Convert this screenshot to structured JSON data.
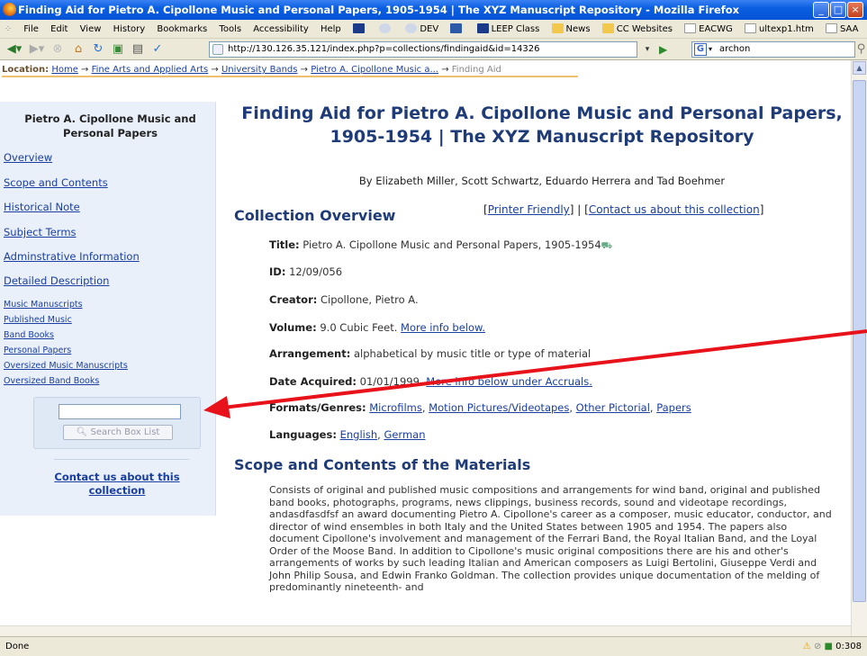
{
  "window": {
    "title": "Finding Aid for Pietro A. Cipollone Music and Personal Papers, 1905-1954 | The XYZ Manuscript Repository - Mozilla Firefox"
  },
  "menu": [
    "File",
    "Edit",
    "View",
    "History",
    "Bookmarks",
    "Tools",
    "Accessibility",
    "Help"
  ],
  "bookmarks": [
    "DEV",
    "LEEP Class",
    "News",
    "CC Websites",
    "EACWG",
    "ultexp1.htm",
    "SAA"
  ],
  "nav": {
    "url": "http://130.126.35.121/index.php?p=collections/findingaid&id=14326",
    "search_value": "archon"
  },
  "breadcrumb": {
    "label": "Location:",
    "items": [
      "Home",
      "Fine Arts and Applied Arts",
      "University Bands",
      "Pietro A. Cipollone Music a..."
    ],
    "current": "Finding Aid"
  },
  "sidebar": {
    "title": "Pietro A. Cipollone Music and Personal Papers",
    "links": [
      "Overview",
      "Scope and Contents",
      "Historical Note",
      "Subject Terms",
      "Adminstrative Information",
      "Detailed Description"
    ],
    "sublinks": [
      "Music Manuscripts",
      "Published Music",
      "Band Books",
      "Personal Papers",
      "Oversized Music Manuscripts",
      "Oversized Band Books"
    ],
    "search_button": "Search Box List",
    "contact": "Contact us about this collection"
  },
  "main": {
    "title": "Finding Aid for Pietro A. Cipollone Music and Personal Papers, 1905-1954 | The XYZ Manuscript Repository",
    "authors": "By Elizabeth Miller, Scott Schwartz, Eduardo Herrera and Tad Boehmer",
    "overview_heading": "Collection Overview",
    "printer_friendly": "Printer Friendly",
    "contact_collection": "Contact us about this collection",
    "fields": {
      "title_label": "Title:",
      "title_value": "Pietro A. Cipollone Music and Personal Papers, 1905-1954",
      "id_label": "ID:",
      "id_value": "12/09/056",
      "creator_label": "Creator:",
      "creator_value": "Cipollone, Pietro A.",
      "volume_label": "Volume:",
      "volume_value": "9.0 Cubic Feet.",
      "volume_link": "More info below.",
      "arrangement_label": "Arrangement:",
      "arrangement_value": "alphabetical by music title or type of material",
      "date_label": "Date Acquired:",
      "date_value": "01/01/1999.",
      "date_link": "More info below under Accruals.",
      "formats_label": "Formats/Genres:",
      "formats": [
        "Microfilms",
        "Motion Pictures/Videotapes",
        "Other Pictorial",
        "Papers"
      ],
      "languages_label": "Languages:",
      "languages": [
        "English",
        "German"
      ]
    },
    "scope_heading": "Scope and Contents of the Materials",
    "scope_text": "Consists of original and published music compositions and arrangements for wind band, original and published band books, photographs, programs, news clippings, business records, sound and videotape recordings, andasdfasdfsf an award documenting Pietro A. Cipollone's career as a composer, music educator, conductor, and director of wind ensembles in both Italy and the United States between 1905 and 1954. The papers also document Cipollone's involvement and management of the Ferrari Band, the Royal Italian Band, and the Loyal Order of the Moose Band. In addition to Cipollone's music original compositions there are his and other's arrangements of works by such leading Italian and American composers as Luigi Bertolini, Giuseppe Verdi and John Philip Sousa, and Edwin Franko Goldman. The collection provides unique documentation of the melding of predominantly nineteenth- and"
  },
  "status": {
    "text": "Done",
    "time": "0:308"
  },
  "colors": {
    "titlebar": "#0a5fe0",
    "heading": "#1f3c78",
    "link": "#1a3fa0",
    "sidebar_bg": "#eaf0f9",
    "annotation_arrow": "#e8121b"
  }
}
